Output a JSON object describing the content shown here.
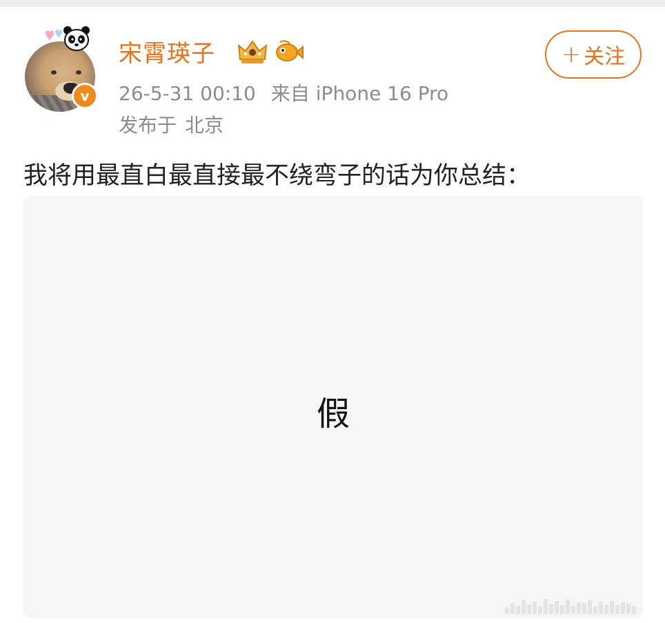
{
  "post": {
    "author": {
      "name": "宋霄瑛子",
      "verified_mark": "v",
      "icons": [
        "panda-icon",
        "crown-badge-icon",
        "fish-badge-icon"
      ]
    },
    "meta": {
      "time": "26-5-31 00:10",
      "source": "来自 iPhone 16 Pro"
    },
    "location": {
      "prefix": "发布于",
      "place": "北京"
    },
    "follow": {
      "plus": "+",
      "label": "关注"
    },
    "text": "我将用最直白最直接最不绕弯子的话为你总结：",
    "image_text": "假"
  },
  "colors": {
    "accent": "#e8711a",
    "meta_gray": "#8c8c8c",
    "image_bg": "#f6f6f6"
  }
}
